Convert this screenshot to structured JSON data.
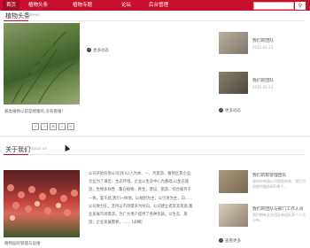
{
  "nav": {
    "items": [
      {
        "label": "首页",
        "active": true
      },
      {
        "label": "植物头条",
        "active": false
      },
      {
        "label": "植物专题",
        "active": false
      },
      {
        "label": "论坛",
        "active": false
      },
      {
        "label": "后台管理",
        "active": false
      }
    ],
    "search_icon": "search-icon"
  },
  "news": {
    "title": "植物头条",
    "subtitle": "News",
    "caption": "蕨类植物以前是喂猪的,没有看懂！",
    "more_label": "更多动态",
    "more_right_label": "更多动态",
    "side_items": [
      {
        "title": "我们的团队",
        "sub": "2015-01-23"
      },
      {
        "title": "我们的团队",
        "sub": "2015-01-23"
      }
    ],
    "share_icons": [
      "print-icon",
      "share-icon",
      "copy-icon",
      "link-icon",
      "email-icon"
    ]
  },
  "about": {
    "title": "关于我们",
    "subtitle": "About us",
    "caption": "植物园的管理与运维",
    "paragraph": "公司开始有限公司(民)以人为本、一、为旅游、植物区景企业;企业为了满足，生态环境。企业以生态中心为基础,以生态旅游，生物多样性...集在植物、养生，建设、旅游、综合服务于一体。鉴于此,我们一体地，以规划为主，以引进为主，向……公司致力在。坚持以市场需求为导向，公司建立者及其资源,集业发展市场需求。为广大用户提供了各种优质。以生态、旅游；企业发展需要，…… [详细]",
    "side_items": [
      {
        "title": "我们的职管理团队",
        "sub": "深圳市有限公司管理系统，我们为你提供服务800多个..."
      },
      {
        "title": "我们的团队与部门工作人员",
        "sub": "我们拥有业务团队有团队多个人员分布..."
      }
    ],
    "more_label": "查看更多"
  }
}
